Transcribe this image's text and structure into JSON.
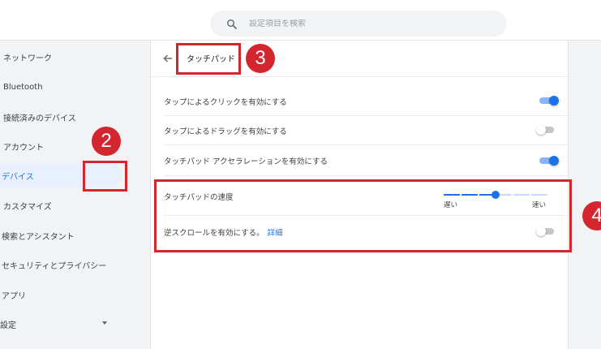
{
  "search": {
    "placeholder": "設定項目を検索",
    "icon": "search-icon"
  },
  "sidebar": {
    "items": [
      {
        "label": "ネットワーク"
      },
      {
        "label": "Bluetooth"
      },
      {
        "label": "接続済みのデバイス"
      },
      {
        "label": "アカウント"
      },
      {
        "label": "デバイス",
        "active": true
      },
      {
        "label": "カスタマイズ"
      },
      {
        "label": "検索とアシスタント"
      },
      {
        "label": "セキュリティとプライバシー"
      },
      {
        "label": "アプリ"
      },
      {
        "label": "設定",
        "icon": "chevron-down-icon"
      }
    ]
  },
  "page": {
    "title": "タッチパッド",
    "back_icon": "arrow-back-icon",
    "settings": [
      {
        "label": "タップによるクリックを有効にする",
        "toggle": true
      },
      {
        "label": "タップによるドラッグを有効にする",
        "toggle": false
      },
      {
        "label": "タッチパッド アクセラレーションを有効にする",
        "toggle": true
      },
      {
        "label": "タッチパッドの速度",
        "slider": {
          "min_label": "遅い",
          "max_label": "速い",
          "value": 0.5
        }
      },
      {
        "label": "逆スクロールを有効にする。",
        "link": "詳細",
        "toggle": false
      }
    ]
  },
  "annotations": [
    {
      "number": "2"
    },
    {
      "number": "3"
    },
    {
      "number": "4"
    }
  ],
  "colors": {
    "accent": "#1a73e8",
    "callout": "#d3262f"
  }
}
